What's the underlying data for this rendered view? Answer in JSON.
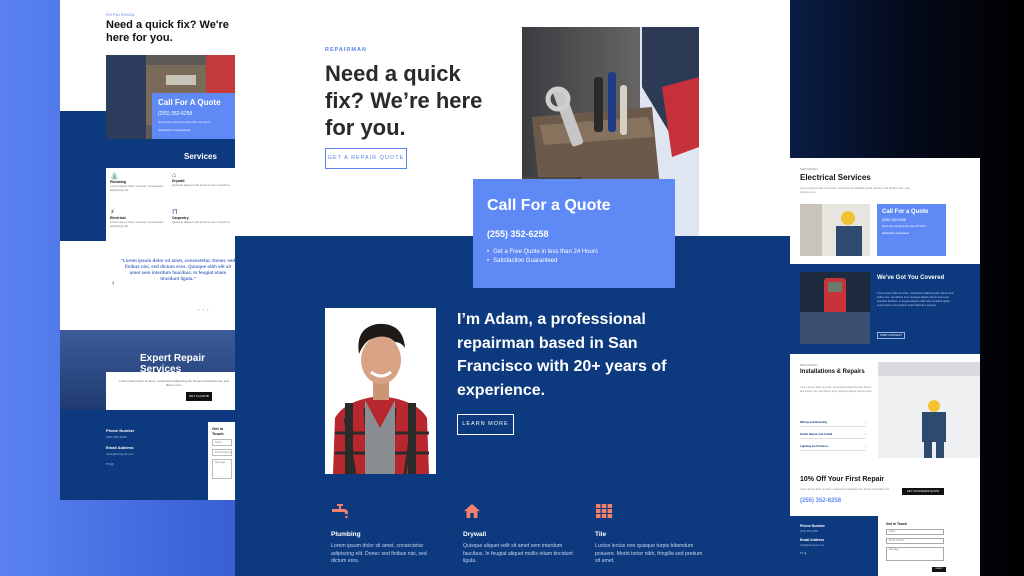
{
  "left_mockup": {
    "label": "REPAIRMAN",
    "title": "Need a quick fix? We're here for you.",
    "quote_title": "Call For A Quote",
    "quote_phone": "(255) 352-6258",
    "quote_bullets": [
      "Get a Free Quote in less than 24 Hours",
      "Satisfaction Guaranteed"
    ],
    "services_title": "Services",
    "services": [
      {
        "icon": "faucet-icon",
        "title": "Plumbing",
        "desc": "Lorem ipsum dolor sit amet, consectetur adipiscing elit."
      },
      {
        "icon": "house-icon",
        "title": "Drywall",
        "desc": "Quisque aliquet velit sit amet sem interdum."
      },
      {
        "icon": "bolt-icon",
        "title": "Electrical",
        "desc": "Lorem ipsum dolor sit amet, consectetur adipiscing elit."
      },
      {
        "icon": "chair-icon",
        "title": "Carpentry",
        "desc": "Quisque aliquet velit sit amet sem interdum."
      }
    ],
    "testimonial": "\"Lorem ipsum dolor sit amet, consectetur. Donec sed finibus nisi, sed dictum eros. Quisque nibh elit sit amet sem interdum faucibus. In feugiat etiam tincidunt ligula.\"",
    "hero2_title": "Expert Repair Services",
    "hero2_text": "Lorem ipsum dolor sit amet, consectetur adipiscing elit. Donec sed finibus nisi, sed dictum eros.",
    "hero2_button": "GET A QUOTE",
    "footer_phone_label": "Phone Number",
    "footer_phone": "(255) 352-6258",
    "footer_email_label": "Email Address",
    "footer_email": "hello@divirepair.com",
    "form_title": "Get in Touch",
    "form_fields": [
      "Name",
      "Email Address",
      "Message"
    ]
  },
  "center_mockup": {
    "label": "REPAIRMAN",
    "title": "Need a quick fix? We’re here for you.",
    "cta_button": "GET A REPAIR QUOTE",
    "quote_title": "Call For a Quote",
    "quote_phone": "(255) 352-6258",
    "quote_bullets": [
      "Get a Free Quote in less than 24 Hours",
      "Satisfaction Guaranteed"
    ],
    "intro": "I’m Adam, a professional repairman based in San Francisco with 20+ years of experience.",
    "learn_more": "LEARN MORE",
    "services": [
      {
        "icon": "faucet-icon",
        "title": "Plumbing",
        "desc": "Lorem ipsum dolor sit amet, consectetur adipiscing elit. Donec sed finibus nisi, sed dictum eros."
      },
      {
        "icon": "house-icon",
        "title": "Drywall",
        "desc": "Quisque aliquet velit sit amet sem interdum faucibus. In feugiat aliquet mollis etiam tincidunt ligula."
      },
      {
        "icon": "tile-icon",
        "title": "Tile",
        "desc": "Luctus lectus non quisque turpis bibendum posuere. Morbi tortor nibh, fringilla sed pretium sit amet."
      }
    ]
  },
  "right_mockup": {
    "label": "REPAIRMAN",
    "title": "Electrical Services",
    "subtitle": "Lorem ipsum dolor sit amet, consectetur adipiscing elit. Donec sed finibus nisi, sed dictum eros.",
    "quote_title": "Call For a Quote",
    "quote_phone": "(255) 352-6258",
    "quote_bullets": [
      "Get a Free Quote in less than 24 Hours",
      "Satisfaction Guaranteed"
    ],
    "covered_title": "We've Got You Covered",
    "covered_text": "Lorem ipsum dolor sit amet, consectetur adipiscing elit. Donec sed finibus nisi, sed dictum eros. Quisque aliquet velit sit amet sem interdum faucibus. In feugiat aliquet mollis etiam tincidunt ligula. Luctus lectus non quisque turpis bibendum posuere.",
    "covered_button": "START A PROJECT",
    "install_label": "REPAIRMAN",
    "install_title": "Installations & Repairs",
    "install_text": "Lorem ipsum dolor sit amet, consectetur adipiscing elit. Donec sed finibus nisi, sed dictum eros. Quisque aliquet velit sit amet.",
    "accordion": [
      "Wiring and Rewiring",
      "Outlet Repair and Install",
      "Lighting and Fixtures"
    ],
    "offer_title": "10% Off Your First Repair",
    "offer_text": "Lorem ipsum dolor sit amet, consectetur adipiscing elit. Donec sed finibus nisi.",
    "offer_phone": "(255) 352-6258",
    "offer_button": "GET YOUR REPAIR QUOTE",
    "footer_phone_label": "Phone Number",
    "footer_phone": "(255) 352-6258",
    "footer_email_label": "Email Address",
    "footer_email": "hello@divirepair.com",
    "form_title": "Get in Touch",
    "form_fields": [
      "Name",
      "Email Address",
      "Message"
    ],
    "form_submit": "SUBMIT"
  },
  "colors": {
    "navy": "#0d3a7e",
    "accent_blue": "#5f8af5",
    "label_blue": "#5a82ea",
    "service_icon": "#f2806c"
  }
}
